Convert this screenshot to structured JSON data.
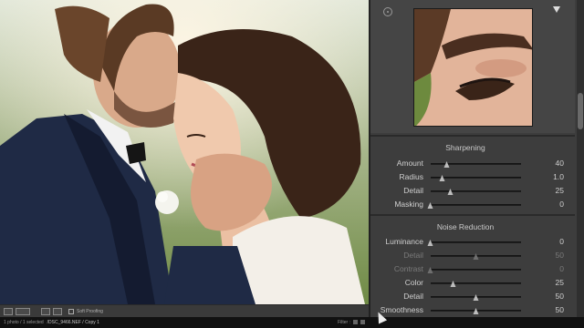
{
  "toolbar": {
    "soft_proofing_label": "Soft Proofing"
  },
  "statusbar": {
    "count_text": "1 photo / 1 selected",
    "file_path": "/DSC_9466.NEF / Copy 1",
    "filter_label": "Filter :"
  },
  "sharpening": {
    "title": "Sharpening",
    "rows": [
      {
        "label": "Amount",
        "value": "40",
        "level": 0.18
      },
      {
        "label": "Radius",
        "value": "1.0",
        "level": 0.13
      },
      {
        "label": "Detail",
        "value": "25",
        "level": 0.22
      },
      {
        "label": "Masking",
        "value": "0",
        "level": 0.0
      }
    ]
  },
  "noise_reduction": {
    "title": "Noise Reduction",
    "rows": [
      {
        "label": "Luminance",
        "value": "0",
        "level": 0.0,
        "dim": false
      },
      {
        "label": "Detail",
        "value": "50",
        "level": 0.5,
        "dim": true
      },
      {
        "label": "Contrast",
        "value": "0",
        "level": 0.0,
        "dim": true
      },
      {
        "label": "Color",
        "value": "25",
        "level": 0.25,
        "dim": false
      },
      {
        "label": "Detail",
        "value": "50",
        "level": 0.5,
        "dim": false
      },
      {
        "label": "Smoothness",
        "value": "50",
        "level": 0.5,
        "dim": false
      }
    ]
  },
  "colors": {
    "panel": "#3d3d3d",
    "track": "#1e1e1e",
    "thumb": "#bdbdbd"
  }
}
